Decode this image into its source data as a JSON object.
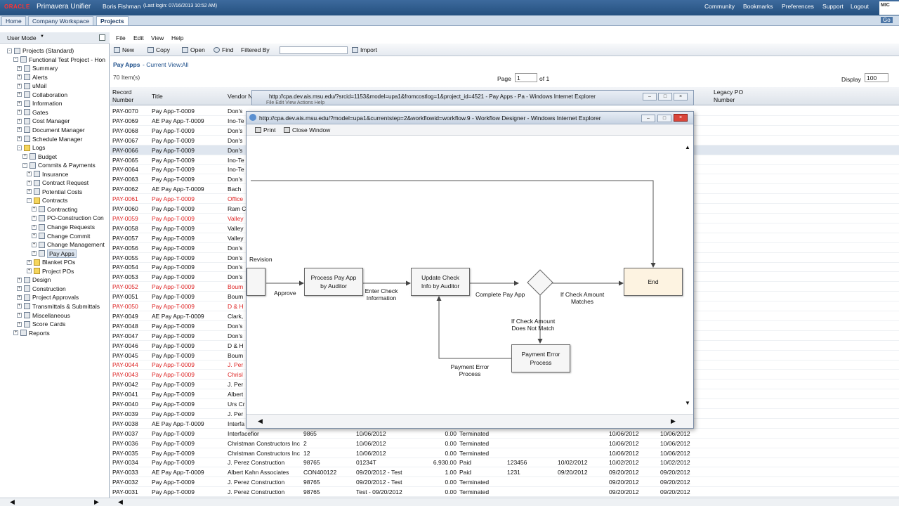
{
  "topbar": {
    "brand": "ORACLE",
    "app": "Primavera Unifier",
    "user": "Boris Fishman",
    "last_login": "(Last login: 07/16/2013 10:52 AM)",
    "links": [
      "Community",
      "Bookmarks",
      "Preferences",
      "Support",
      "Logout"
    ]
  },
  "nav": {
    "tabs": [
      "Home",
      "Company Workspace",
      "Projects"
    ],
    "right_go": "Go"
  },
  "sidebar": {
    "user_mode": "User Mode",
    "tree": [
      {
        "label": "Projects (Standard)",
        "lvl": 1,
        "ex": "-",
        "icon": "doc"
      },
      {
        "label": "Functional Test Project - Hon",
        "lvl": 2,
        "ex": "-",
        "icon": "doc"
      },
      {
        "label": "Summary",
        "lvl": 3,
        "ex": "+",
        "icon": "doc"
      },
      {
        "label": "Alerts",
        "lvl": 3,
        "ex": "+",
        "icon": "doc"
      },
      {
        "label": "uMail",
        "lvl": 3,
        "ex": "+",
        "icon": "doc"
      },
      {
        "label": "Collaboration",
        "lvl": 3,
        "ex": "+",
        "icon": "doc"
      },
      {
        "label": "Information",
        "lvl": 3,
        "ex": "+",
        "icon": "doc"
      },
      {
        "label": "Gates",
        "lvl": 3,
        "ex": "+",
        "icon": "doc"
      },
      {
        "label": "Cost Manager",
        "lvl": 3,
        "ex": "+",
        "icon": "doc"
      },
      {
        "label": "Document Manager",
        "lvl": 3,
        "ex": "+",
        "icon": "doc"
      },
      {
        "label": "Schedule Manager",
        "lvl": 3,
        "ex": "+",
        "icon": "doc"
      },
      {
        "label": "Logs",
        "lvl": 3,
        "ex": "-",
        "icon": "folder"
      },
      {
        "label": "Budget",
        "lvl": 4,
        "ex": "+",
        "icon": "doc"
      },
      {
        "label": "Commits & Payments",
        "lvl": 4,
        "ex": "-",
        "icon": "doc"
      },
      {
        "label": "Insurance",
        "lvl": 5,
        "ex": "+",
        "icon": "doc"
      },
      {
        "label": "Contract Request",
        "lvl": 5,
        "ex": "+",
        "icon": "doc"
      },
      {
        "label": "Potential Costs",
        "lvl": 5,
        "ex": "+",
        "icon": "doc"
      },
      {
        "label": "Contracts",
        "lvl": 5,
        "ex": "-",
        "icon": "folder"
      },
      {
        "label": "Contracting",
        "lvl": 6,
        "ex": "+",
        "icon": "doc"
      },
      {
        "label": "PO-Construction Con",
        "lvl": 6,
        "ex": "+",
        "icon": "doc"
      },
      {
        "label": "Change Requests",
        "lvl": 6,
        "ex": "+",
        "icon": "doc"
      },
      {
        "label": "Change Commit",
        "lvl": 6,
        "ex": "+",
        "icon": "doc"
      },
      {
        "label": "Change Management",
        "lvl": 6,
        "ex": "+",
        "icon": "doc"
      },
      {
        "label": "Pay Apps",
        "lvl": 6,
        "ex": "+",
        "icon": "doc",
        "sel": true
      },
      {
        "label": "Blanket POs",
        "lvl": 5,
        "ex": "+",
        "icon": "folder"
      },
      {
        "label": "Project POs",
        "lvl": 5,
        "ex": "+",
        "icon": "folder"
      },
      {
        "label": "Design",
        "lvl": 3,
        "ex": "+",
        "icon": "doc"
      },
      {
        "label": "Construction",
        "lvl": 3,
        "ex": "+",
        "icon": "doc"
      },
      {
        "label": "Project Approvals",
        "lvl": 3,
        "ex": "+",
        "icon": "doc"
      },
      {
        "label": "Transmittals & Submittals",
        "lvl": 3,
        "ex": "+",
        "icon": "doc"
      },
      {
        "label": "Miscellaneous",
        "lvl": 3,
        "ex": "+",
        "icon": "doc"
      },
      {
        "label": "Score Cards",
        "lvl": 3,
        "ex": "+",
        "icon": "doc"
      },
      {
        "label": "Reports",
        "lvl": 2,
        "ex": "+",
        "icon": "doc"
      }
    ]
  },
  "menu": {
    "items": [
      "File",
      "Edit",
      "View",
      "Help"
    ]
  },
  "toolbar": {
    "new": "New",
    "copy": "Copy",
    "open": "Open",
    "find": "Find",
    "filtered_by": "Filtered By",
    "import": "Import"
  },
  "list": {
    "title": "Pay Apps",
    "view_label": "- Current View:",
    "view_value": "All",
    "count": "70 Item(s)",
    "page_label": "Page",
    "page_value": "1",
    "page_of": "of 1",
    "display_label": "Display",
    "display_value": "100"
  },
  "grid": {
    "headers": {
      "record": "Record",
      "record2": "Number",
      "title": "Title",
      "vendor": "Vendor N",
      "legacy": "Legacy PO",
      "legacy2": "Number"
    },
    "rows": [
      {
        "c": [
          "PAY-0070",
          "Pay App-T-0009",
          "Don's"
        ]
      },
      {
        "c": [
          "PAY-0069",
          "AE Pay App-T-0009",
          "Ino-Te"
        ]
      },
      {
        "c": [
          "PAY-0068",
          "Pay App-T-0009",
          "Don's"
        ]
      },
      {
        "c": [
          "PAY-0067",
          "Pay App-T-0009",
          "Don's"
        ]
      },
      {
        "c": [
          "PAY-0066",
          "Pay App-T-0009",
          "Don's"
        ],
        "hl": true
      },
      {
        "c": [
          "PAY-0065",
          "Pay App-T-0009",
          "Ino-Te"
        ]
      },
      {
        "c": [
          "PAY-0064",
          "Pay App-T-0009",
          "Ino-Te"
        ]
      },
      {
        "c": [
          "PAY-0063",
          "Pay App-T-0009",
          "Don's"
        ]
      },
      {
        "c": [
          "PAY-0062",
          "AE Pay App-T-0009",
          "Bach"
        ]
      },
      {
        "c": [
          "PAY-0061",
          "Pay App-T-0009",
          "Office"
        ],
        "red": true
      },
      {
        "c": [
          "PAY-0060",
          "Pay App-T-0009",
          "Ram C"
        ]
      },
      {
        "c": [
          "PAY-0059",
          "Pay App-T-0009",
          "Valley"
        ],
        "red": true
      },
      {
        "c": [
          "PAY-0058",
          "Pay App-T-0009",
          "Valley"
        ]
      },
      {
        "c": [
          "PAY-0057",
          "Pay App-T-0009",
          "Valley"
        ]
      },
      {
        "c": [
          "PAY-0056",
          "Pay App-T-0009",
          "Don's"
        ]
      },
      {
        "c": [
          "PAY-0055",
          "Pay App-T-0009",
          "Don's"
        ]
      },
      {
        "c": [
          "PAY-0054",
          "Pay App-T-0009",
          "Don's"
        ]
      },
      {
        "c": [
          "PAY-0053",
          "Pay App-T-0009",
          "Don's"
        ]
      },
      {
        "c": [
          "PAY-0052",
          "Pay App-T-0009",
          "Boum"
        ],
        "red": true
      },
      {
        "c": [
          "PAY-0051",
          "Pay App-T-0009",
          "Boum"
        ]
      },
      {
        "c": [
          "PAY-0050",
          "Pay App-T-0009",
          "D & H"
        ],
        "red": true
      },
      {
        "c": [
          "PAY-0049",
          "AE Pay App-T-0009",
          "Clark,"
        ]
      },
      {
        "c": [
          "PAY-0048",
          "Pay App-T-0009",
          "Don's"
        ]
      },
      {
        "c": [
          "PAY-0047",
          "Pay App-T-0009",
          "Don's"
        ]
      },
      {
        "c": [
          "PAY-0046",
          "Pay App-T-0009",
          "D & H"
        ]
      },
      {
        "c": [
          "PAY-0045",
          "Pay App-T-0009",
          "Boum"
        ]
      },
      {
        "c": [
          "PAY-0044",
          "Pay App-T-0009",
          "J. Per"
        ],
        "red": true
      },
      {
        "c": [
          "PAY-0043",
          "Pay App-T-0009",
          "Chrisl"
        ],
        "red": true
      },
      {
        "c": [
          "PAY-0042",
          "Pay App-T-0009",
          "J. Per"
        ]
      },
      {
        "c": [
          "PAY-0041",
          "Pay App-T-0009",
          "Albert"
        ]
      },
      {
        "c": [
          "PAY-0040",
          "Pay App-T-0009",
          "Urs Cr"
        ]
      },
      {
        "c": [
          "PAY-0039",
          "Pay App-T-0009",
          "J. Per"
        ]
      },
      {
        "c": [
          "PAY-0038",
          "AE Pay App-T-0009",
          "Interfa"
        ]
      },
      {
        "c": [
          "PAY-0037",
          "Pay App-T-0009",
          "Interfacefior",
          "9865",
          "10/06/2012",
          "0.00",
          "Terminated",
          "",
          "",
          "10/06/2012",
          "10/06/2012"
        ]
      },
      {
        "c": [
          "PAY-0036",
          "Pay App-T-0009",
          "Christman Constructors Inc",
          "2",
          "10/06/2012",
          "0.00",
          "Terminated",
          "",
          "",
          "10/06/2012",
          "10/06/2012"
        ]
      },
      {
        "c": [
          "PAY-0035",
          "Pay App-T-0009",
          "Christman Constructors Inc",
          "12",
          "10/06/2012",
          "0.00",
          "Terminated",
          "",
          "",
          "10/06/2012",
          "10/06/2012"
        ]
      },
      {
        "c": [
          "PAY-0034",
          "Pay App-T-0009",
          "J. Perez Construction",
          "98765",
          "01234T",
          "6,930.00",
          "Paid",
          "123456",
          "10/02/2012",
          "10/02/2012",
          "10/02/2012"
        ]
      },
      {
        "c": [
          "PAY-0033",
          "AE Pay App-T-0009",
          "Albert Kahn Associates",
          "CON400122",
          "09/20/2012 - Test",
          "1.00",
          "Paid",
          "1231",
          "09/20/2012",
          "09/20/2012",
          "09/20/2012"
        ]
      },
      {
        "c": [
          "PAY-0032",
          "Pay App-T-0009",
          "J. Perez Construction",
          "98765",
          "09/20/2012 - Test",
          "0.00",
          "Terminated",
          "",
          "",
          "09/20/2012",
          "09/20/2012"
        ]
      },
      {
        "c": [
          "PAY-0031",
          "Pay App-T-0009",
          "J. Perez Construction",
          "98765",
          "Test - 09/20/2012",
          "0.00",
          "Terminated",
          "",
          "",
          "09/20/2012",
          "09/20/2012"
        ]
      }
    ]
  },
  "popup_back": {
    "title": "http://cpa.dev.ais.msu.edu/?srcid=1153&model=upa1&fromcostlog=1&project_id=4521 - Pay Apps - Pa - Windows Internet Explorer",
    "menu": "File   Edit   View   Actions   Help"
  },
  "popup": {
    "title": "http://cpa.dev.ais.msu.edu/?model=upa1&currentstep=2&workflowid=workflow.9 - Workflow Designer - Windows Internet Explorer",
    "print": "Print",
    "close": "Close Window"
  },
  "workflow": {
    "revision": "Revision",
    "approve": "Approve",
    "process": "Process Pay App by Auditor",
    "enter_check": "Enter Check Information",
    "update_check": "Update Check Info by Auditor",
    "complete": "Complete Pay App",
    "if_match": "If Check Amount Matches",
    "if_not_match": "If Check Amount Does Not Match",
    "payment_error": "Payment Error Process",
    "payment_error_label": "Payment Error Process",
    "end": "End"
  }
}
